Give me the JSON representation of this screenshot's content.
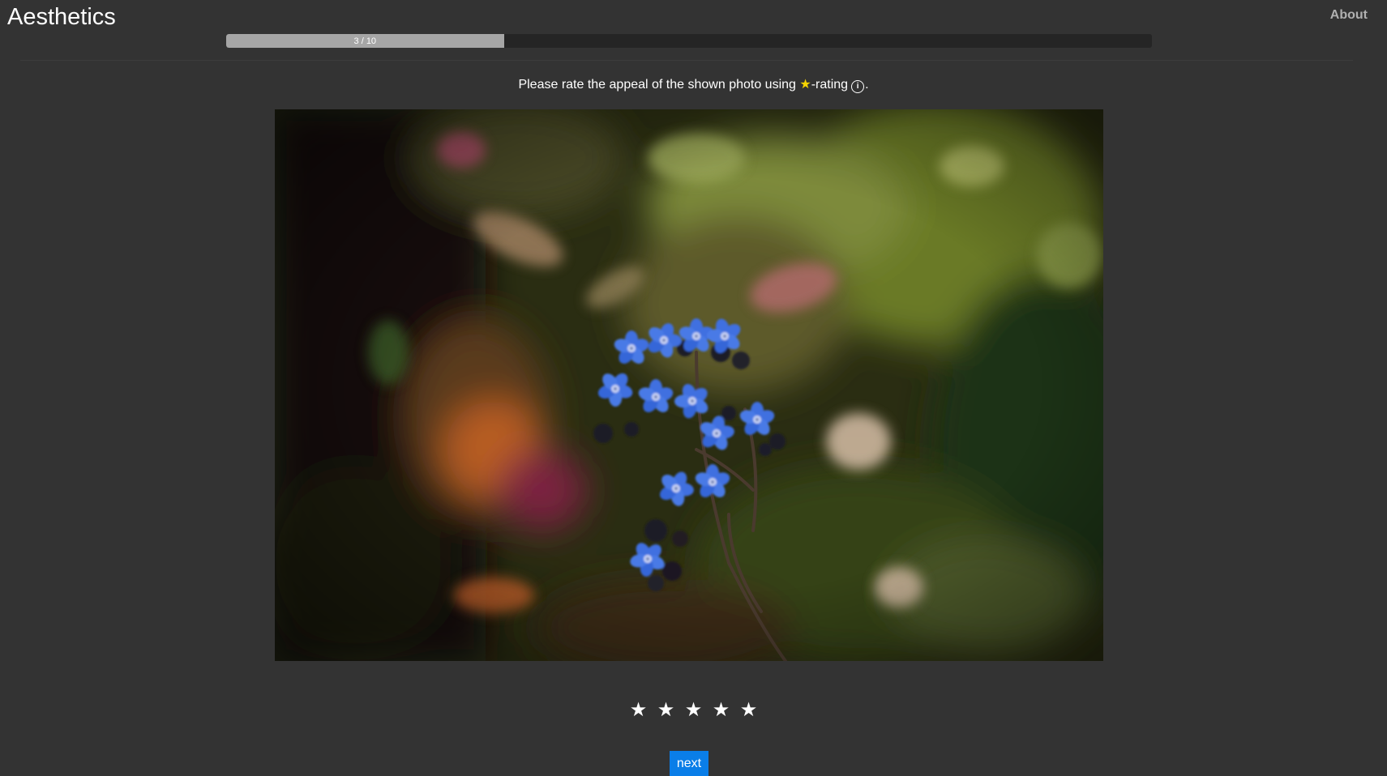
{
  "header": {
    "title": "Aesthetics",
    "about_label": "About"
  },
  "progress": {
    "label": "3 / 10",
    "fraction": 0.3
  },
  "prompt": {
    "before": "Please rate the appeal of the shown photo using ",
    "star": "★",
    "after": "-rating",
    "info": "i",
    "end": "."
  },
  "rating": {
    "stars": [
      "★",
      "★",
      "★",
      "★",
      "★"
    ],
    "selected": 0
  },
  "actions": {
    "next_label": "next"
  },
  "colors": {
    "background": "#333333",
    "accent": "#0a7ee8",
    "star_highlight": "#f5d300",
    "progress_fill": "#a6a6a6"
  }
}
